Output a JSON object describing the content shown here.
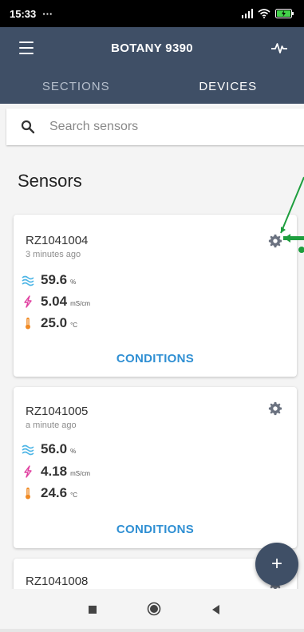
{
  "status_bar": {
    "time": "15:33",
    "dots": "···"
  },
  "app_bar": {
    "title": "BOTANY 9390"
  },
  "tabs": [
    {
      "label": "SECTIONS"
    },
    {
      "label": "DEVICES"
    }
  ],
  "active_tab": "DEVICES",
  "search": {
    "placeholder": "Search sensors",
    "value": ""
  },
  "section_title": "Sensors",
  "sensors": [
    {
      "id": "RZ1041004",
      "updated": "3 minutes ago",
      "moisture": {
        "value": "59.6",
        "unit": "%"
      },
      "conductivity": {
        "value": "5.04",
        "unit": "mS/cm"
      },
      "temperature": {
        "value": "25.0",
        "unit": "°C"
      },
      "action": "CONDITIONS"
    },
    {
      "id": "RZ1041005",
      "updated": "a minute ago",
      "moisture": {
        "value": "56.0",
        "unit": "%"
      },
      "conductivity": {
        "value": "4.18",
        "unit": "mS/cm"
      },
      "temperature": {
        "value": "24.6",
        "unit": "°C"
      },
      "action": "CONDITIONS"
    },
    {
      "id": "RZ1041008"
    }
  ],
  "fab_label": "+",
  "colors": {
    "app_bar": "#3f4f66",
    "accent_link": "#2f8fd3",
    "moisture_icon": "#4fb6e6",
    "conductivity_icon": "#e040a0",
    "temperature_icon": "#f08a24",
    "annotation_arrow": "#1e9e3e"
  },
  "icons": [
    "menu-icon",
    "pulse-icon",
    "search-icon",
    "gear-icon",
    "water-icon",
    "lightning-icon",
    "thermometer-icon",
    "plus-icon",
    "nav-square-icon",
    "nav-circle-icon",
    "nav-back-icon"
  ]
}
